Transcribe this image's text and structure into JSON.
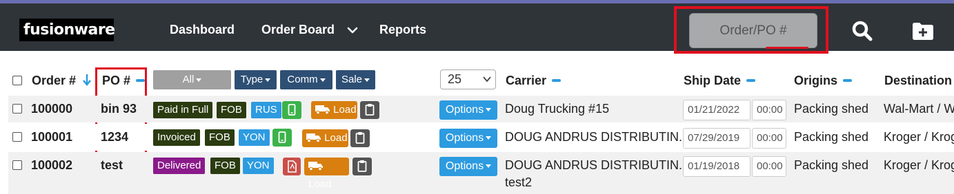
{
  "app": {
    "logo_text": "fusionware",
    "nav": {
      "dashboard": "Dashboard",
      "order_board": "Order Board",
      "reports": "Reports"
    },
    "search_placeholder": "Order/PO #",
    "icons": {
      "search": "search-icon",
      "add_folder": "folder-plus-icon",
      "nav_dropdown": "chevron-down-icon"
    }
  },
  "table": {
    "headers": {
      "order": "Order #",
      "po": "PO #",
      "carrier": "Carrier",
      "ship_date": "Ship Date",
      "origins": "Origins",
      "destination": "Destination"
    },
    "filters": {
      "all": "All",
      "type": "Type",
      "comm": "Comm",
      "sale": "Sale"
    },
    "per_page": "25",
    "rows": [
      {
        "order": "100000",
        "po": "bin 93",
        "status": "Paid in Full",
        "terms": "FOB",
        "comm": "RUS",
        "load": "Load",
        "options": "Options",
        "carrier": "Doug Trucking #15",
        "carrier_sub": "",
        "ship_date": "01/21/2022",
        "ship_time": "00:00",
        "origin": "Packing shed",
        "destination": "Wal-Mart / W"
      },
      {
        "order": "100001",
        "po": "1234",
        "status": "Invoiced",
        "terms": "FOB",
        "comm": "YON",
        "load": "Load",
        "options": "Options",
        "carrier": "DOUG ANDRUS DISTRIBUTIN...",
        "carrier_sub": "",
        "ship_date": "07/29/2019",
        "ship_time": "00:00",
        "origin": "Packing shed",
        "destination": "Kroger / Krog"
      },
      {
        "order": "100002",
        "po": "test",
        "status": "Delivered",
        "terms": "FOB",
        "comm": "YON",
        "load": "Load",
        "options": "Options",
        "carrier": "DOUG ANDRUS DISTRIBUTIN...",
        "carrier_sub": "test2",
        "ship_date": "01/19/2018",
        "ship_time": "00:00",
        "origin": "Packing shed",
        "destination": "Kroger / Krog"
      }
    ]
  },
  "colors": {
    "navbar": "#2f3439",
    "accent_blue": "#2d9be0",
    "highlight_red": "#e0101e",
    "status_paid": "#2b3b10",
    "status_invoiced": "#2b3b10",
    "status_delivered": "#8a1a8a",
    "terms": "#2b3b10",
    "comm": "#2d9be0",
    "phone_green": "#3cb34a",
    "pdf_red": "#c9504a",
    "load_orange": "#d87f0f",
    "clipboard": "#545454",
    "filter_dark": "#2e4f74",
    "filter_all": "#a0a0a0"
  }
}
